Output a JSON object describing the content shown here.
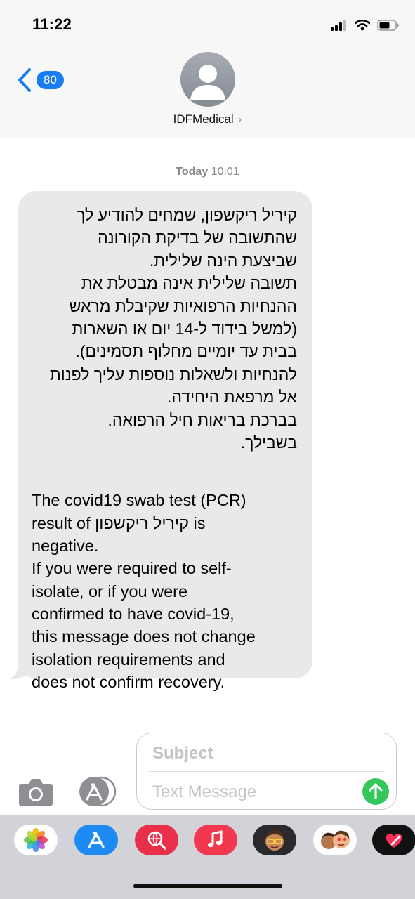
{
  "status_bar": {
    "time": "11:22"
  },
  "header": {
    "back_badge": "80",
    "contact_name": "IDFMedical",
    "contact_chevron": "›"
  },
  "timestamp": {
    "day": "Today",
    "time": "10:01"
  },
  "message": {
    "hebrew": "קיריל ריקשפון, שמחים להודיע לך\nשהתשובה של בדיקת הקורונה\nשביצעת הינה שלילית.\nתשובה שלילית אינה מבטלת את\nההנחיות הרפואיות שקיבלת מראש\n(למשל בידוד ל-14 יום או השארות\nבבית עד יומיים מחלוף תסמינים).\nלהנחיות ולשאלות נוספות עליך לפנות\nאל מרפאת היחידה.\nבברכת בריאות  חיל הרפואה.\nבשבילך.",
    "english": "The covid19 swab test (PCR)\nresult of קיריל ריקשפון is\nnegative.\nIf you were required to self-\nisolate, or if you were\nconfirmed to have covid-19,\nthis message does not change\nisolation requirements and\ndoes not confirm recovery."
  },
  "compose": {
    "subject_placeholder": "Subject",
    "message_placeholder": "Text Message"
  },
  "app_drawer": {
    "apps": [
      "photos-icon",
      "app-store-icon",
      "web-search-icon",
      "music-icon",
      "memoji-icon",
      "memoji-stickers-icon",
      "digital-touch-icon"
    ]
  },
  "colors": {
    "accent": "#1a7cf5",
    "bubble": "#e9e9eb",
    "send": "#34c759"
  }
}
